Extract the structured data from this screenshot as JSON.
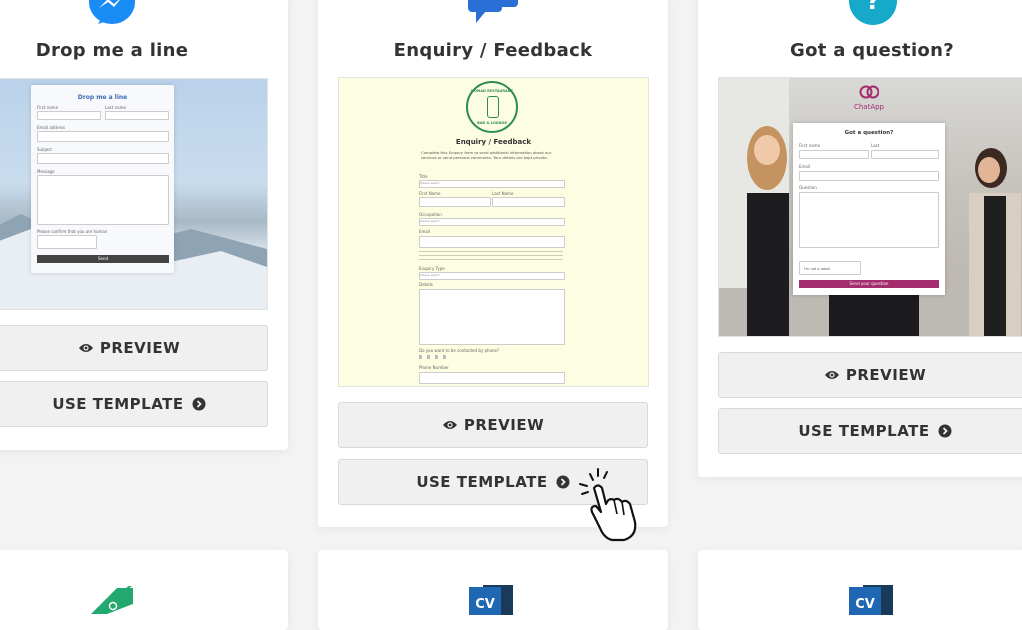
{
  "colors": {
    "page_bg": "#f3f3f4",
    "button_bg": "#f0f0f0",
    "messenger_blue": "#1a8cf5",
    "chat_blue": "#2a6fd6",
    "question_teal": "#17a9c9",
    "feedback_bg": "#fdfde1",
    "restaurant_green": "#2e8b57",
    "chatapp_purple": "#a32b6e"
  },
  "cards": [
    {
      "icon": "messenger-icon",
      "title": "Drop me a line",
      "preview_label": "PREVIEW",
      "use_label": "USE TEMPLATE",
      "thumb": {
        "form_title": "Drop me a line",
        "fields": [
          "First name",
          "Last name",
          "Email address",
          "Subject",
          "Message"
        ],
        "recaptcha_label": "Please confirm that you are human",
        "send_label": "Send"
      }
    },
    {
      "icon": "chat-bubbles-icon",
      "title": "Enquiry / Feedback",
      "preview_label": "PREVIEW",
      "use_label": "USE TEMPLATE",
      "thumb": {
        "logo_top": "NOMAD RESTAURANT",
        "logo_bottom": "BAR & LOUNGE",
        "form_title": "Enquiry / Feedback",
        "intro": "Complete this Enquiry form to send additional information about our services or send personal comments. Your details are kept private.",
        "fields": [
          "Title",
          "First Name",
          "Last Name",
          "Occupation",
          "Email",
          "Enquiry Type",
          "Details",
          "Do you want to be contacted by phone?",
          "Phone Number"
        ],
        "select_placeholder": "Please select"
      }
    },
    {
      "icon": "question-mark-icon",
      "title": "Got a question?",
      "preview_label": "PREVIEW",
      "use_label": "USE TEMPLATE",
      "thumb": {
        "brand": "ChatApp",
        "form_title": "Got a question?",
        "fields": [
          "First name",
          "Last",
          "Email",
          "Question"
        ],
        "recaptcha_label": "I'm not a robot",
        "send_label": "Send your question"
      }
    }
  ],
  "bottom_row": [
    {
      "icon": "price-tag-icon"
    },
    {
      "icon": "cv-icon",
      "text": "CV"
    },
    {
      "icon": "cv-icon",
      "text": "CV"
    }
  ]
}
